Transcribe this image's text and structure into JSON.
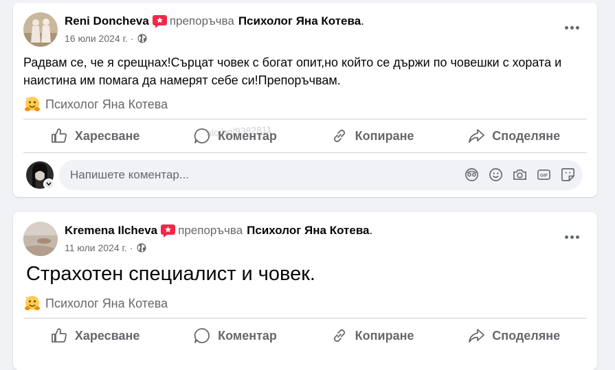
{
  "posts": [
    {
      "author": "Reni Doncheva",
      "recommends": "препоръчва",
      "page": "Психолог Яна Котева",
      "dot": ".",
      "date": "16 юли 2024 г. ·",
      "text": "Радвам се, че я срещнах!Сърцат човек с богат опит,но който се държи по човешки с хората и наистина им помага да намерят себе си!Препоръчвам.",
      "tag": "Психолог Яна Котева"
    },
    {
      "author": "Kremena Ilcheva",
      "recommends": "препоръчва",
      "page": "Психолог Яна Котева",
      "dot": ".",
      "date": "11 юли 2024 г. ·",
      "text": "Страхотен специалист и човек.",
      "tag": "Психолог Яна Котева"
    }
  ],
  "actions": {
    "like": "Харесване",
    "comment": "Коментар",
    "copy": "Копиране",
    "share": "Споделяне"
  },
  "comment_box": {
    "placeholder": "Напишете коментар..."
  },
  "watermark": "alo.bg/9382811",
  "colors": {
    "secondary_text": "#65676b",
    "card_bg": "#ffffff",
    "page_bg": "#f0f2f5",
    "badge": "#f02849"
  },
  "icons": [
    "recommend-badge-icon",
    "globe-icon",
    "more-icon",
    "hugging-face-icon",
    "like-icon",
    "comment-icon",
    "link-icon",
    "share-icon",
    "avatar-sticker-icon",
    "emoji-icon",
    "camera-icon",
    "gif-icon",
    "sticker-icon"
  ]
}
